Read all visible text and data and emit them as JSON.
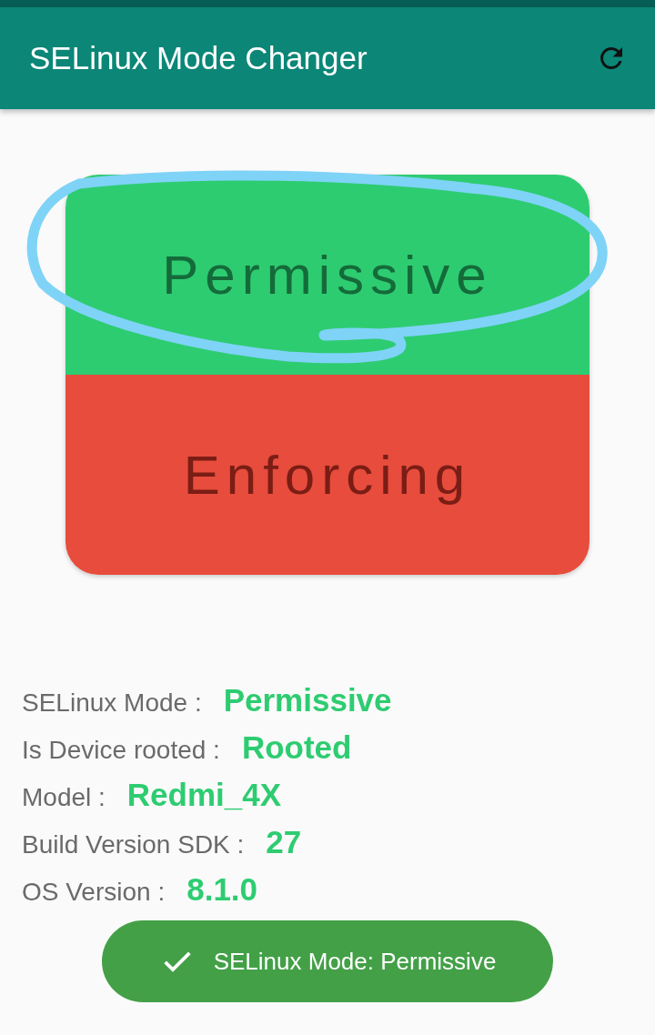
{
  "app_bar": {
    "title": "SELinux Mode Changer"
  },
  "modes": [
    {
      "label": "Permissive",
      "kind": "permissive"
    },
    {
      "label": "Enforcing",
      "kind": "enforcing"
    }
  ],
  "info": [
    {
      "label": "SELinux Mode :",
      "value": "Permissive"
    },
    {
      "label": "Is Device rooted :",
      "value": "Rooted"
    },
    {
      "label": "Model :",
      "value": "Redmi_4X"
    },
    {
      "label": "Build Version SDK :",
      "value": "27"
    },
    {
      "label": "OS Version :",
      "value": "8.1.0"
    }
  ],
  "toast": {
    "text": "SELinux Mode: Permissive"
  }
}
